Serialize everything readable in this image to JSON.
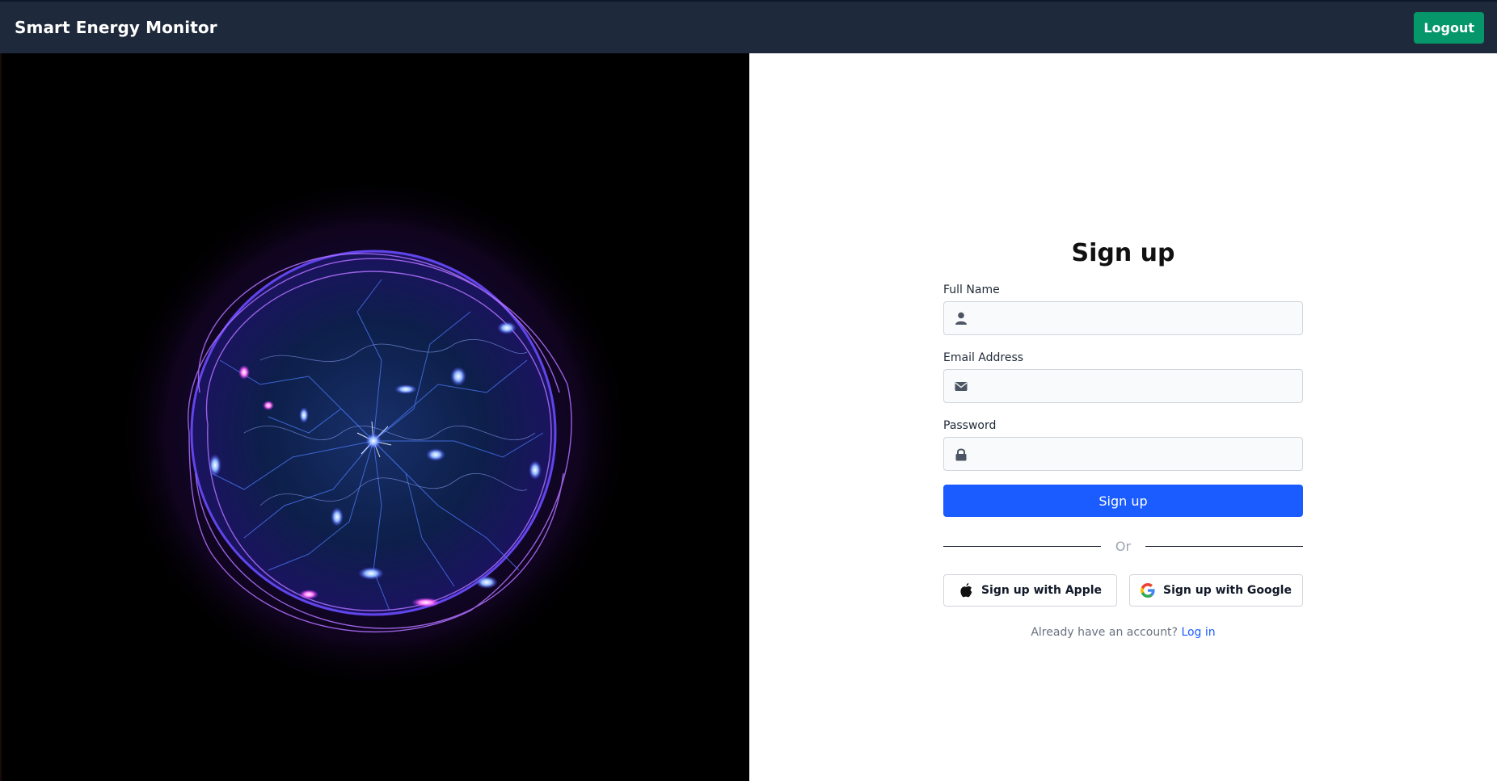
{
  "navbar": {
    "brand": "Smart Energy Monitor",
    "logout_label": "Logout"
  },
  "hero": {
    "image": "plasma-energy-orb"
  },
  "form": {
    "title": "Sign up",
    "fields": [
      {
        "label": "Full Name",
        "value": "",
        "icon": "user-icon"
      },
      {
        "label": "Email Address",
        "value": "",
        "icon": "envelope-icon"
      },
      {
        "label": "Password",
        "value": "",
        "icon": "lock-icon"
      }
    ],
    "submit_label": "Sign up",
    "divider_text": "Or",
    "apple_label": "Sign up with Apple",
    "google_label": "Sign up with Google",
    "login_prompt": "Already have an account?",
    "login_link": "Log in"
  },
  "colors": {
    "navbar_bg": "#1e293b",
    "logout_bg": "#059669",
    "primary": "#1a5cff",
    "hero_bg": "#000000"
  }
}
